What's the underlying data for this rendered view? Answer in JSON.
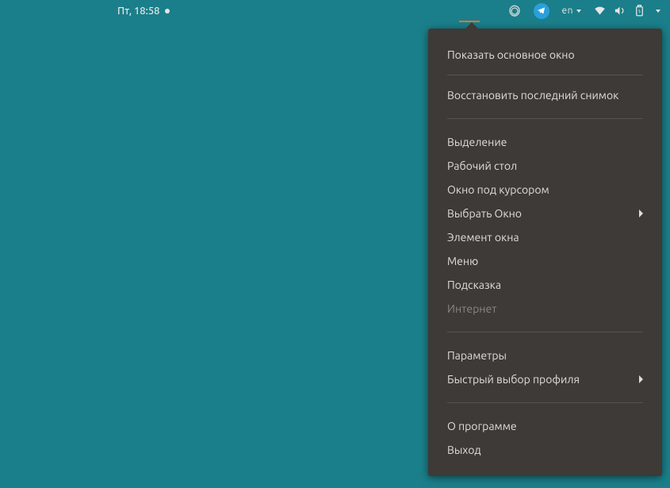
{
  "topbar": {
    "clock": "Пт, 18:58",
    "lang": "en"
  },
  "menu": {
    "show_main_window": "Показать основное окно",
    "restore_last_snapshot": "Восстановить последний снимок",
    "selection": "Выделение",
    "desktop": "Рабочий стол",
    "window_under_cursor": "Окно под курсором",
    "select_window": "Выбрать Окно",
    "window_element": "Элемент окна",
    "menu": "Меню",
    "tooltip": "Подсказка",
    "internet": "Интернет",
    "preferences": "Параметры",
    "quick_profile_select": "Быстрый выбор профиля",
    "about": "О программе",
    "quit": "Выход"
  }
}
